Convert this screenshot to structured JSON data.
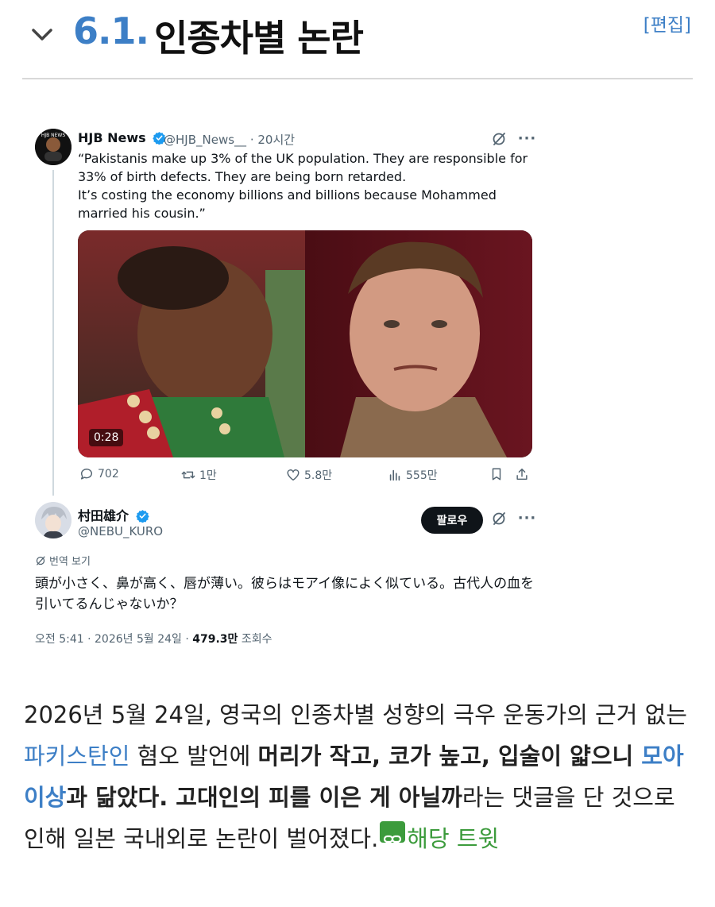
{
  "section": {
    "number": "6.1.",
    "title": "인종차별 논란",
    "edit_label": "[편집]"
  },
  "tweet": {
    "author_name": "HJB News",
    "author_handle": "@HJB_News__",
    "time_sep": "·",
    "time": "20시간",
    "text": "“Pakistanis make up 3% of the UK population. They are responsible for 33% of birth defects. They are being born retarded.\nIt’s costing the economy billions and billions because Mohammed married his cousin.”",
    "video_duration": "0:28",
    "replies": "702",
    "retweets": "1만",
    "likes": "5.8만",
    "views": "555만"
  },
  "reply": {
    "author_name": "村田雄介",
    "author_handle": "@NEBU_KURO",
    "follow_label": "팔로우",
    "translate_label": "번역 보기",
    "text": "頭が小さく、鼻が高く、唇が薄い。彼らはモアイ像によく似ている。古代人の血を引いてるんじゃないか？",
    "timestamp": "오전 5:41 · 2026년 5월 24일 · ",
    "views_count": "479.3만",
    "views_label": " 조회수"
  },
  "paragraph": {
    "p1": "2026년 5월 24일, 영국의 인종차별 성향의 극우 운동가의 근거 없는 ",
    "link1": "파키스탄인",
    "p2": " 혐오 발언에 ",
    "b1": "머리가 작고, 코가 높고, 입술이 얇으니 ",
    "link2": "모아이상",
    "b2": "과 닮았다. 고대인의 피를 이은 게 아닐까",
    "p3": "라는 댓글을 단 것으로 인해 일본 국내외로 논란이 벌어졌다.",
    "source_label": "해당 트윗"
  },
  "colors": {
    "accent": "#3d7fc6",
    "source_link": "#3c9b3c",
    "follow_button": "#0f1419"
  },
  "icons": [
    "chevron-down-icon",
    "verified-badge-icon",
    "grok-icon",
    "more-icon",
    "reply-icon",
    "retweet-icon",
    "like-icon",
    "views-icon",
    "bookmark-icon",
    "share-icon",
    "translate-icon",
    "external-link-icon"
  ]
}
